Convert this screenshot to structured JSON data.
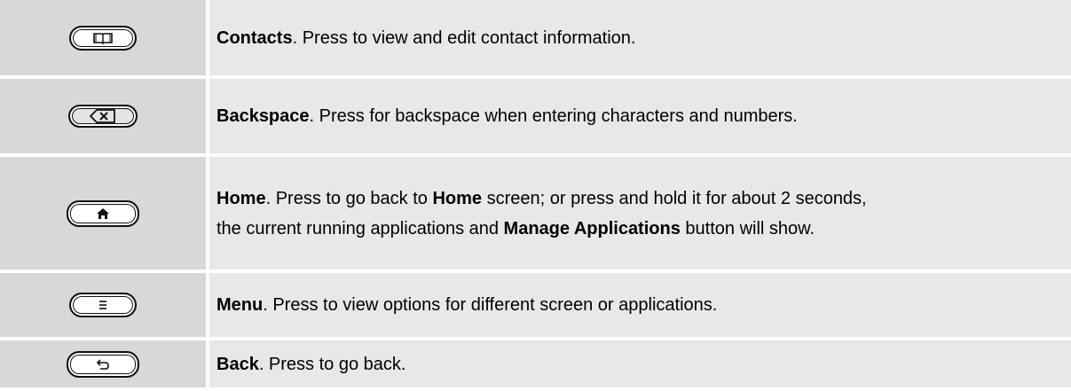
{
  "rows": [
    {
      "icon": "contacts-book-icon",
      "title": "Contacts",
      "text": ". Press to view and edit contact information."
    },
    {
      "icon": "backspace-icon",
      "title": "Backspace",
      "text": ". Press for backspace when entering characters and numbers."
    },
    {
      "icon": "home-icon",
      "title": "Home",
      "line1_text": ". Press to go back to ",
      "line1_bold": "Home",
      "line1_end": " screen; or press and hold it for about 2 seconds,",
      "line2_start": "the current running applications and ",
      "line2_bold": "Manage Applications",
      "line2_end": " button will show."
    },
    {
      "icon": "menu-icon",
      "title": "Menu",
      "text": ". Press to view options for different screen or applications."
    },
    {
      "icon": "back-arrow-icon",
      "title": "Back",
      "text": ". Press to go back."
    }
  ]
}
